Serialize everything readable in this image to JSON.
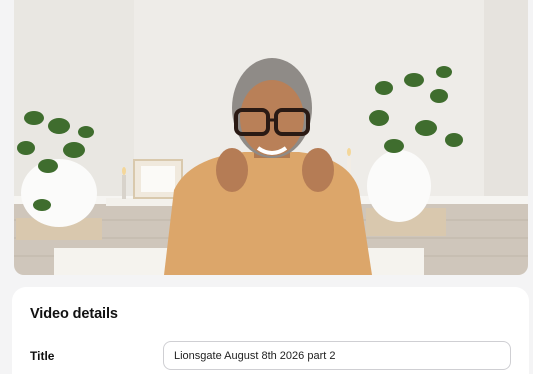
{
  "video": {
    "description": "Video preview"
  },
  "details": {
    "heading": "Video details",
    "title_label": "Title",
    "title_value": "Lionsgate August 8th 2026 part 2"
  }
}
